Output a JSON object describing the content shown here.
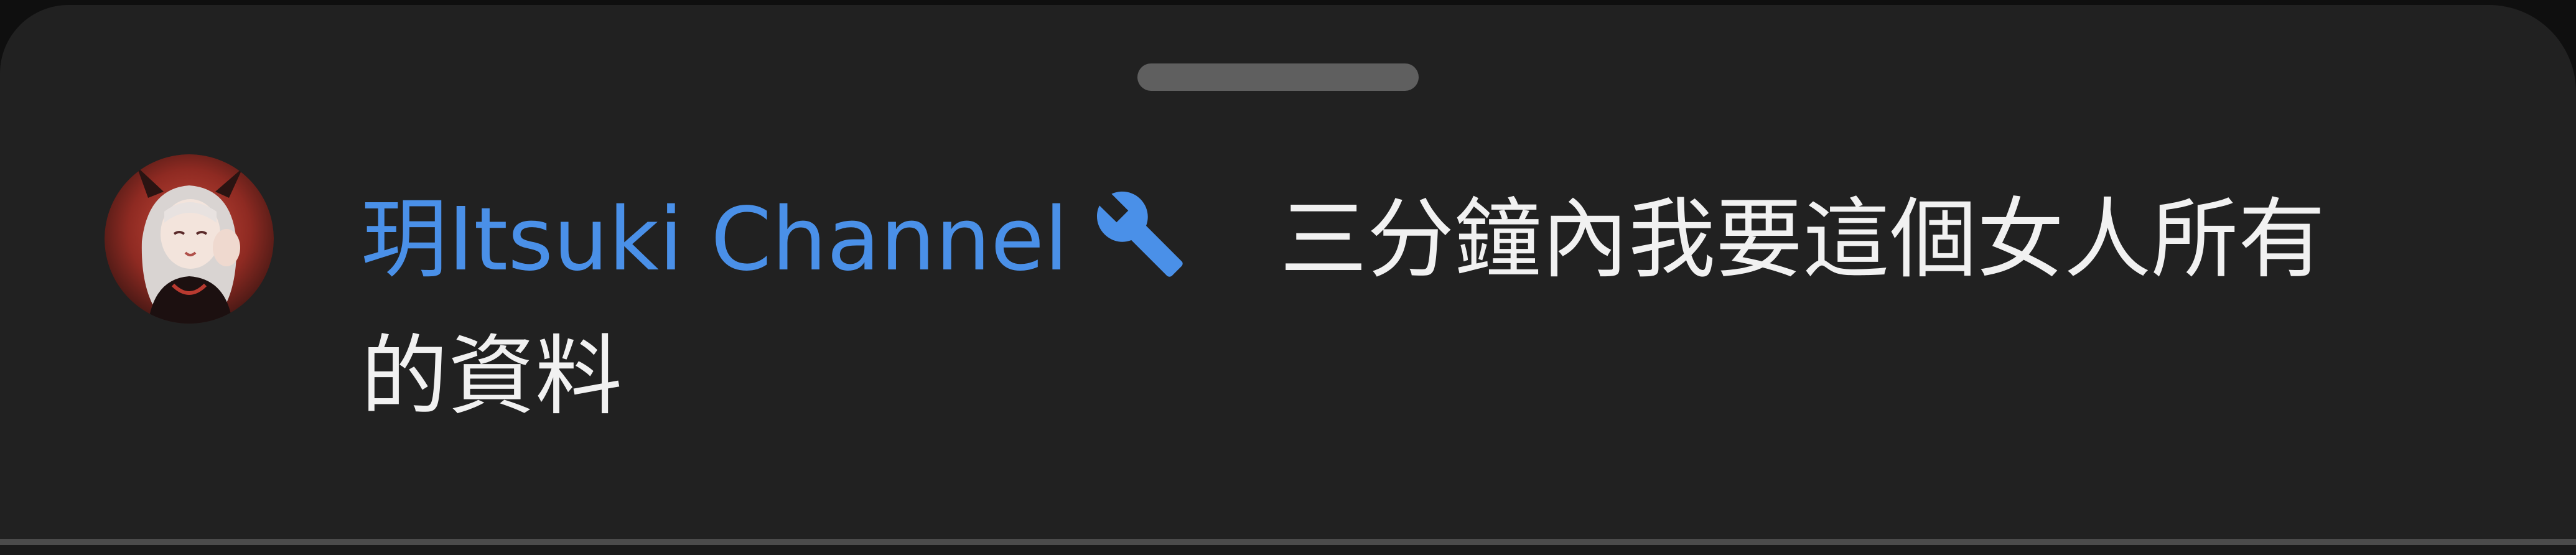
{
  "comment": {
    "author": "玥Itsuki Channel",
    "author_badge_icon": "wrench-icon",
    "text_line1": "三分鐘內我要這個女人所有",
    "text_line2": "的資料"
  },
  "colors": {
    "sheet_background": "#212121",
    "author_link": "#4a90e8",
    "comment_text": "#f1f1f1",
    "drag_handle": "#5f5f5f"
  },
  "avatar": {
    "icon": "user-avatar"
  }
}
